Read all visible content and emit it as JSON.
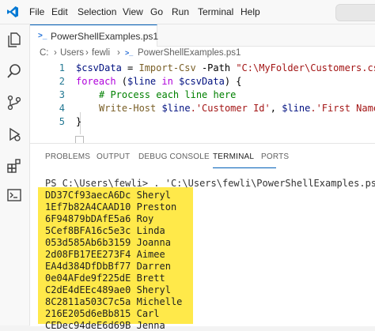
{
  "menu": [
    "File",
    "Edit",
    "Selection",
    "View",
    "Go",
    "Run",
    "Terminal",
    "Help"
  ],
  "tab": {
    "label": "PowerShellExamples.ps1",
    "icon": "powershell-file-icon"
  },
  "breadcrumb": [
    "C:",
    "Users",
    "fewli",
    "PowerShellExamples.ps1"
  ],
  "line_numbers": [
    "1",
    "2",
    "3",
    "4",
    "5"
  ],
  "code": {
    "l1": {
      "var": "$csvData",
      "eq": " = ",
      "cmd": "Import-Csv",
      "param": " -Path ",
      "str": "\"C:\\MyFolder\\Customers.csv\""
    },
    "l2": {
      "kw": "foreach",
      "open": " (",
      "var1": "$line",
      "kw2": " in ",
      "var2": "$csvData",
      "close": ") {"
    },
    "l3": {
      "comment": "# Process each line here"
    },
    "l4": {
      "cmd": "Write-Host",
      "sp": " ",
      "var1": "$line",
      "str1": ".'Customer Id'",
      "comma": ", ",
      "var2": "$line",
      "str2": ".'First Name'"
    },
    "l5": {
      "close": "}"
    }
  },
  "panel_tabs": [
    "PROBLEMS",
    "OUTPUT",
    "DEBUG CONSOLE",
    "TERMINAL",
    "PORTS"
  ],
  "active_panel_tab": "TERMINAL",
  "terminal": {
    "prompt": "PS C:\\Users\\fewli> . 'C:\\Users\\fewli\\PowerShellExamples.ps1'",
    "rows": [
      {
        "id": "DD37Cf93aecA6Dc",
        "name": "Sheryl"
      },
      {
        "id": "1Ef7b82A4CAAD10",
        "name": "Preston"
      },
      {
        "id": "6F94879bDAfE5a6",
        "name": "Roy"
      },
      {
        "id": "5Cef8BFA16c5e3c",
        "name": "Linda"
      },
      {
        "id": "053d585Ab6b3159",
        "name": "Joanna"
      },
      {
        "id": "2d08FB17EE273F4",
        "name": "Aimee"
      },
      {
        "id": "EA4d384DfDbBf77",
        "name": "Darren"
      },
      {
        "id": "0e04AFde9f225dE",
        "name": "Brett"
      },
      {
        "id": "C2dE4dEEc489ae0",
        "name": "Sheryl"
      },
      {
        "id": "8C2811a503C7c5a",
        "name": "Michelle"
      },
      {
        "id": "216E205d6eBb815",
        "name": "Carl"
      },
      {
        "id": "CEDec94deE6d69B",
        "name": "Jenna"
      }
    ]
  },
  "colors": {
    "highlight": "#ffe94a",
    "accent": "#005fb8"
  }
}
